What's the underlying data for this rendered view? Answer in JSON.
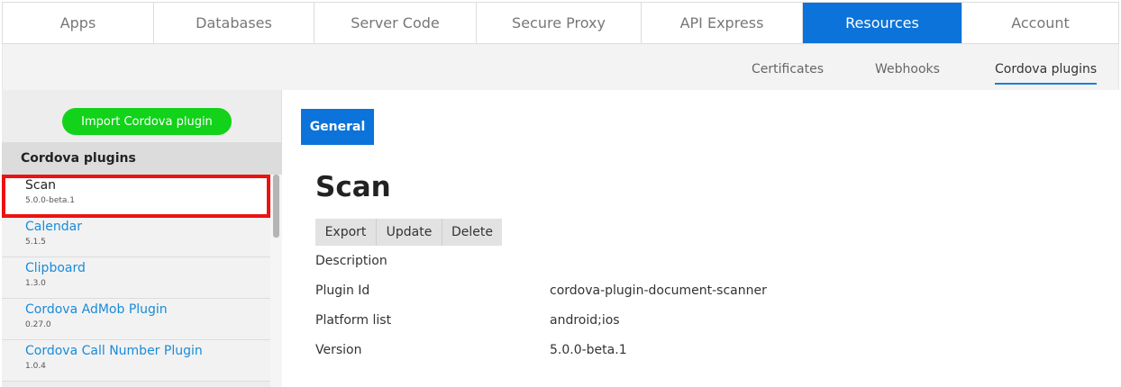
{
  "top_tabs": [
    "Apps",
    "Databases",
    "Server Code",
    "Secure Proxy",
    "API Express",
    "Resources",
    "Account"
  ],
  "active_top_tab": "Resources",
  "sub_tabs": [
    "Certificates",
    "Webhooks",
    "Cordova plugins"
  ],
  "active_sub_tab": "Cordova plugins",
  "sidebar": {
    "import_button": "Import Cordova plugin",
    "header": "Cordova plugins",
    "plugins": [
      {
        "name": "Scan",
        "version": "5.0.0-beta.1"
      },
      {
        "name": "Calendar",
        "version": "5.1.5"
      },
      {
        "name": "Clipboard",
        "version": "1.3.0"
      },
      {
        "name": "Cordova AdMob Plugin",
        "version": "0.27.0"
      },
      {
        "name": "Cordova Call Number Plugin",
        "version": "1.0.4"
      }
    ]
  },
  "main": {
    "general_tab": "General",
    "title": "Scan",
    "actions": {
      "export": "Export",
      "update": "Update",
      "delete": "Delete"
    },
    "fields": {
      "description_label": "Description",
      "plugin_id_label": "Plugin Id",
      "plugin_id_value": "cordova-plugin-document-scanner",
      "platform_label": "Platform list",
      "platform_value": "android;ios",
      "version_label": "Version",
      "version_value": "5.0.0-beta.1"
    }
  },
  "colors": {
    "accent": "#0b73d9",
    "import_green": "#12d21a",
    "selection_highlight": "#ee1111",
    "link": "#1a8bd8"
  }
}
